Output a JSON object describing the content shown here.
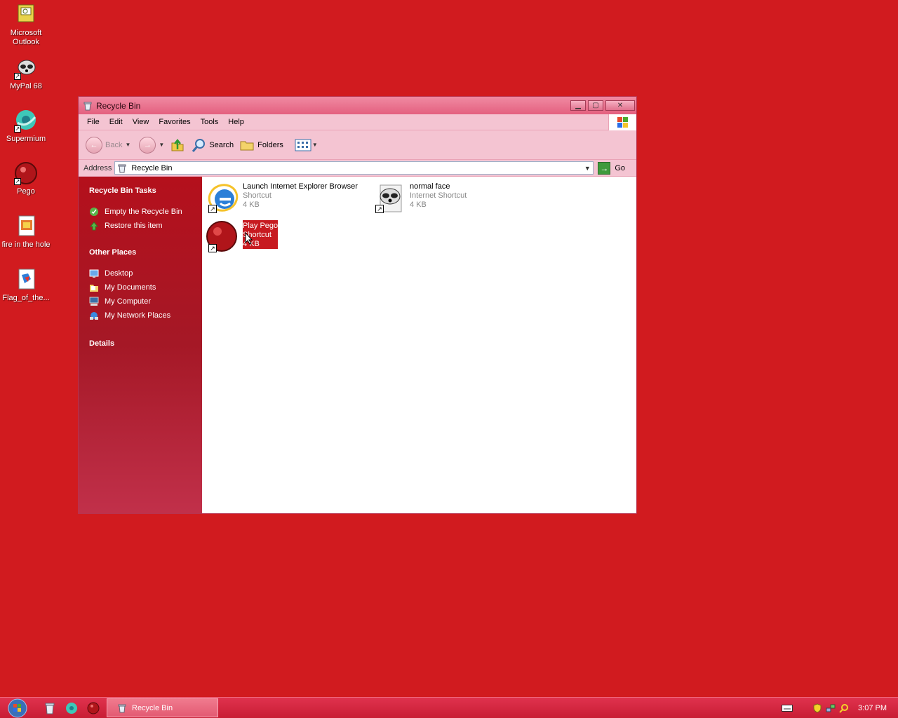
{
  "desktop": {
    "icons": [
      {
        "label": "Microsoft Outlook"
      },
      {
        "label": "MyPal 68"
      },
      {
        "label": "Supermium"
      },
      {
        "label": "Pego"
      },
      {
        "label": "fire in the hole"
      },
      {
        "label": "Flag_of_the..."
      }
    ]
  },
  "window": {
    "title": "Recycle Bin",
    "menu": [
      "File",
      "Edit",
      "View",
      "Favorites",
      "Tools",
      "Help"
    ],
    "toolbar": {
      "back": "Back",
      "search": "Search",
      "folders": "Folders"
    },
    "address": {
      "label": "Address",
      "value": "Recycle Bin",
      "go": "Go"
    },
    "taskpane": {
      "tasks_title": "Recycle Bin Tasks",
      "tasks": [
        "Empty the Recycle Bin",
        "Restore this item"
      ],
      "places_title": "Other Places",
      "places": [
        "Desktop",
        "My Documents",
        "My Computer",
        "My Network Places"
      ],
      "details_title": "Details"
    },
    "files": [
      {
        "name": "Launch Internet Explorer Browser",
        "type": "Shortcut",
        "size": "4 KB"
      },
      {
        "name": "normal face",
        "type": "Internet Shortcut",
        "size": "4 KB"
      },
      {
        "name": "Play Pego",
        "type": "Shortcut",
        "size": "4 KB"
      }
    ]
  },
  "taskbar": {
    "task": "Recycle Bin",
    "clock": "3:07 PM"
  },
  "colors": {
    "desktop": "#d11b1f",
    "selection": "#c71a20",
    "taskpane": "#b4101c"
  }
}
